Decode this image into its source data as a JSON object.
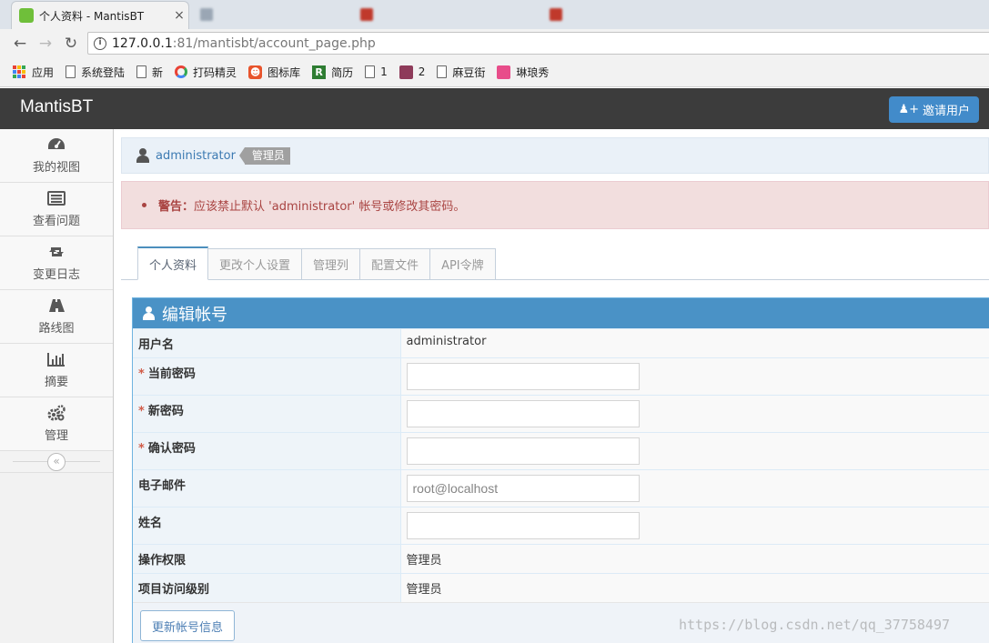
{
  "browser": {
    "active_tab_title": "个人资料 - MantisBT",
    "url_host": "127.0.0.1",
    "url_rest": ":81/mantisbt/account_page.php",
    "bookmarks": [
      {
        "label": "应用",
        "icon": "apps-icon"
      },
      {
        "label": "系统登陆",
        "icon": "page-icon"
      },
      {
        "label": "新",
        "icon": "page-icon"
      },
      {
        "label": "打码精灵",
        "icon": "circle-icon"
      },
      {
        "label": "图标库",
        "icon": "skull-icon"
      },
      {
        "label": "简历",
        "icon": "r-icon"
      },
      {
        "label": "1",
        "icon": "page-icon"
      },
      {
        "label": "2",
        "icon": "grid-icon"
      },
      {
        "label": "麻豆街",
        "icon": "page-icon"
      },
      {
        "label": "琳琅秀",
        "icon": "pink-icon"
      }
    ]
  },
  "navbar": {
    "brand": "MantisBT",
    "invite_label": "邀请用户"
  },
  "sidebar": {
    "items": [
      {
        "label": "我的视图",
        "icon": "dashboard-icon"
      },
      {
        "label": "查看问题",
        "icon": "list-icon"
      },
      {
        "label": "变更日志",
        "icon": "retweet-icon"
      },
      {
        "label": "路线图",
        "icon": "road-icon"
      },
      {
        "label": "摘要",
        "icon": "bar-chart-icon"
      },
      {
        "label": "管理",
        "icon": "gears-icon"
      }
    ],
    "collapse_glyph": "«"
  },
  "breadcrumb": {
    "user": "administrator",
    "role": "管理员"
  },
  "alert": {
    "strong": "警告：",
    "message": "应该禁止默认 'administrator' 帐号或修改其密码。"
  },
  "tabs": [
    {
      "label": "个人资料",
      "active": true
    },
    {
      "label": "更改个人设置",
      "active": false
    },
    {
      "label": "管理列",
      "active": false
    },
    {
      "label": "配置文件",
      "active": false
    },
    {
      "label": "API令牌",
      "active": false
    }
  ],
  "form": {
    "title": "编辑帐号",
    "required_mark": "*",
    "username_label": "用户名",
    "username_value": "administrator",
    "current_password_label": "当前密码",
    "new_password_label": "新密码",
    "confirm_password_label": "确认密码",
    "email_label": "电子邮件",
    "email_value": "root@localhost",
    "realname_label": "姓名",
    "access_label": "操作权限",
    "access_value": "管理员",
    "project_access_label": "项目访问级别",
    "project_access_value": "管理员",
    "submit_label": "更新帐号信息"
  },
  "watermark": "https://blog.csdn.net/qq_37758497"
}
